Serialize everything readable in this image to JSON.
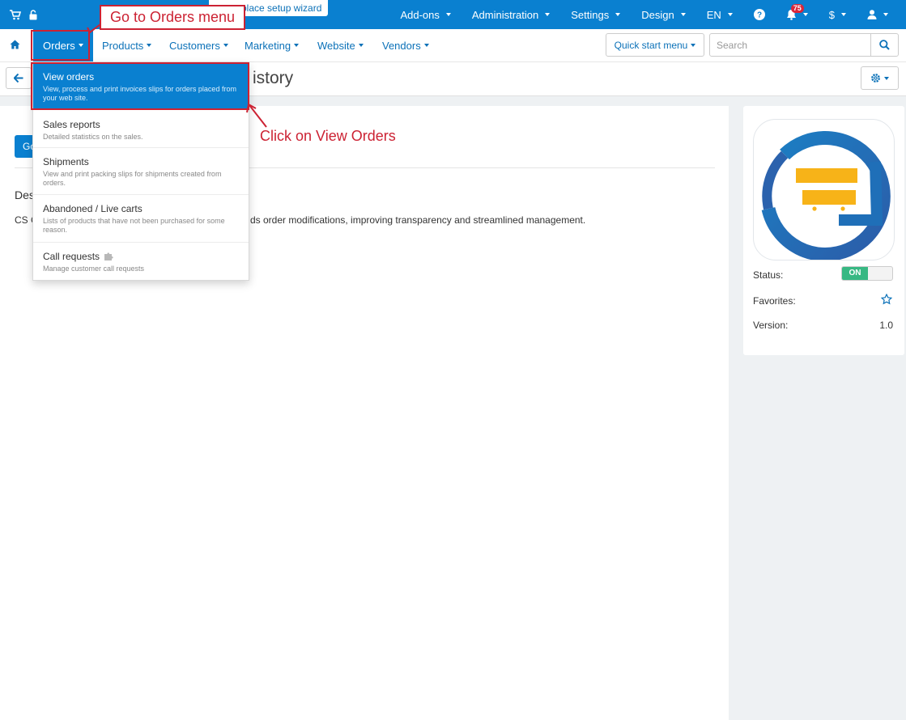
{
  "topbar": {
    "wizard_tab": "place setup wizard",
    "nav": [
      {
        "label": "Add-ons",
        "name": "addons"
      },
      {
        "label": "Administration",
        "name": "administration"
      },
      {
        "label": "Settings",
        "name": "settings"
      },
      {
        "label": "Design",
        "name": "design"
      },
      {
        "label": "EN",
        "name": "language"
      }
    ],
    "notifications_count": "75",
    "currency": "$"
  },
  "mainnav": {
    "items": [
      {
        "label": "Orders",
        "name": "orders"
      },
      {
        "label": "Products",
        "name": "products"
      },
      {
        "label": "Customers",
        "name": "customers"
      },
      {
        "label": "Marketing",
        "name": "marketing"
      },
      {
        "label": "Website",
        "name": "website"
      },
      {
        "label": "Vendors",
        "name": "vendors"
      }
    ],
    "quick_start": "Quick start menu",
    "search_placeholder": "Search"
  },
  "page": {
    "title_visible": "istory",
    "go_button_partial": "Go",
    "description_heading": "Des",
    "description_prefix": "CS C",
    "description_suffix": "ds order modifications, improving transparency and streamlined management."
  },
  "orders_menu": [
    {
      "title": "View orders",
      "desc": "View, process and print invoices slips for orders placed from your web site.",
      "active": true
    },
    {
      "title": "Sales reports",
      "desc": "Detailed statistics on the sales."
    },
    {
      "title": "Shipments",
      "desc": "View and print packing slips for shipments created from orders."
    },
    {
      "title": "Abandoned / Live carts",
      "desc": "Lists of products that have not been purchased for some reason."
    },
    {
      "title": "Call requests",
      "desc": "Manage customer call requests"
    }
  ],
  "sidebar": {
    "status_label": "Status:",
    "status_value": "ON",
    "favorites_label": "Favorites:",
    "version_label": "Version:",
    "version_value": "1.0"
  },
  "annotations": {
    "go_to_orders": "Go to Orders menu",
    "click_view_orders": "Click on View Orders"
  },
  "colors": {
    "topbar": "#0a80d0",
    "annotation": "#cc2233",
    "toggle_on": "#37b883"
  }
}
